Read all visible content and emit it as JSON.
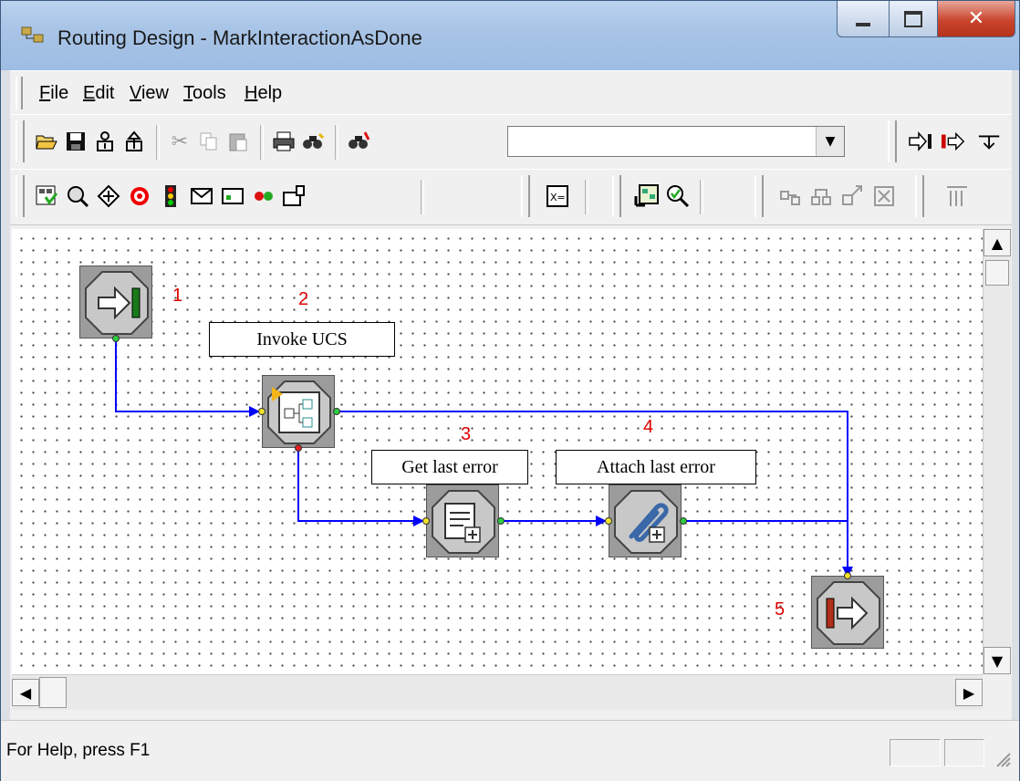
{
  "window": {
    "title": "Routing Design - MarkInteractionAsDone"
  },
  "menu": [
    {
      "label": "File",
      "underline": "F",
      "rest": "ile"
    },
    {
      "label": "Edit",
      "underline": "E",
      "rest": "dit"
    },
    {
      "label": "View",
      "underline": "V",
      "rest": "iew"
    },
    {
      "label": "Tools",
      "underline": "T",
      "rest": "ools"
    },
    {
      "label": "Help",
      "underline": "H",
      "rest": "elp"
    }
  ],
  "toolbar": {
    "find_value": "",
    "icons_row1": [
      "open-icon",
      "save-icon",
      "print-setup-icon",
      "upload-icon",
      "cut-icon",
      "copy-icon",
      "paste-icon",
      "print-icon",
      "find-icon",
      "find-next-icon",
      "entry-icon",
      "exit-icon",
      "next-icon"
    ],
    "icons_row2": [
      "strategy-icon",
      "query-icon",
      "move-icon",
      "target-icon",
      "traffic-icon",
      "mail-icon",
      "message-icon",
      "link-icon",
      "sms-icon",
      "variables-icon",
      "subroutine-icon",
      "check-icon",
      "group-icon",
      "ungroup-icon",
      "expand-icon",
      "delete-icon",
      "columns-icon"
    ]
  },
  "diagram": {
    "blocks": [
      {
        "id": "entry",
        "number": "1",
        "icon": "entry-arrow-icon"
      },
      {
        "id": "invoke",
        "number": "2",
        "label": "Invoke UCS",
        "icon": "subroutine-icon"
      },
      {
        "id": "get-error",
        "number": "3",
        "label": "Get last error",
        "icon": "document-plus-icon"
      },
      {
        "id": "attach-error",
        "number": "4",
        "label": "Attach last error",
        "icon": "paperclip-plus-icon"
      },
      {
        "id": "exit",
        "number": "5",
        "icon": "exit-arrow-icon"
      }
    ]
  },
  "status": {
    "help_text": "For Help, press F1"
  }
}
